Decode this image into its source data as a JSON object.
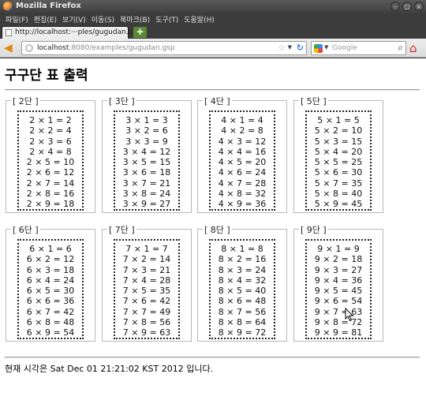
{
  "window": {
    "title": "Mozilla Firefox",
    "buttons": [
      "–",
      "□",
      "×"
    ]
  },
  "menubar": {
    "items": [
      "파일(F)",
      "편집(E)",
      "보기(V)",
      "이동(S)",
      "북마크(B)",
      "도구(T)",
      "도움말(H)"
    ]
  },
  "tab": {
    "label": "http://localhost:···ples/gugudan.gsp",
    "new_tab": "+"
  },
  "navbar": {
    "url_host": "localhost",
    "url_path": ":8080/examples/gugudan.gsp",
    "search_placeholder": "Google"
  },
  "page": {
    "title": "구구단 표 출력",
    "status": "현재 시각은 Sat Dec 01 21:21:02 KST 2012 입니다."
  },
  "tables": [
    {
      "legend": "[ 2단 ]",
      "rows": [
        "2 × 1 = 2",
        "2 × 2 = 4",
        "2 × 3 = 6",
        "2 × 4 = 8",
        "2 × 5 = 10",
        "2 × 6 = 12",
        "2 × 7 = 14",
        "2 × 8 = 16",
        "2 × 9 = 18"
      ]
    },
    {
      "legend": "[ 3단 ]",
      "rows": [
        "3 × 1 = 3",
        "3 × 2 = 6",
        "3 × 3 = 9",
        "3 × 4 = 12",
        "3 × 5 = 15",
        "3 × 6 = 18",
        "3 × 7 = 21",
        "3 × 8 = 24",
        "3 × 9 = 27"
      ]
    },
    {
      "legend": "[ 4단 ]",
      "rows": [
        "4 × 1 = 4",
        "4 × 2 = 8",
        "4 × 3 = 12",
        "4 × 4 = 16",
        "4 × 5 = 20",
        "4 × 6 = 24",
        "4 × 7 = 28",
        "4 × 8 = 32",
        "4 × 9 = 36"
      ]
    },
    {
      "legend": "[ 5단 ]",
      "rows": [
        "5 × 1 = 5",
        "5 × 2 = 10",
        "5 × 3 = 15",
        "5 × 4 = 20",
        "5 × 5 = 25",
        "5 × 6 = 30",
        "5 × 7 = 35",
        "5 × 8 = 40",
        "5 × 9 = 45"
      ]
    },
    {
      "legend": "[ 6단 ]",
      "rows": [
        "6 × 1 = 6",
        "6 × 2 = 12",
        "6 × 3 = 18",
        "6 × 4 = 24",
        "6 × 5 = 30",
        "6 × 6 = 36",
        "6 × 7 = 42",
        "6 × 8 = 48",
        "6 × 9 = 54"
      ]
    },
    {
      "legend": "[ 7단 ]",
      "rows": [
        "7 × 1 = 7",
        "7 × 2 = 14",
        "7 × 3 = 21",
        "7 × 4 = 28",
        "7 × 5 = 35",
        "7 × 6 = 42",
        "7 × 7 = 49",
        "7 × 8 = 56",
        "7 × 9 = 63"
      ]
    },
    {
      "legend": "[ 8단 ]",
      "rows": [
        "8 × 1 = 8",
        "8 × 2 = 16",
        "8 × 3 = 24",
        "8 × 4 = 32",
        "8 × 5 = 40",
        "8 × 6 = 48",
        "8 × 7 = 56",
        "8 × 8 = 64",
        "8 × 9 = 72"
      ]
    },
    {
      "legend": "[ 9단 ]",
      "rows": [
        "9 × 1 = 9",
        "9 × 2 = 18",
        "9 × 3 = 27",
        "9 × 4 = 36",
        "9 × 5 = 45",
        "9 × 6 = 54",
        "9 × 7 = 63",
        "9 × 8 = 72",
        "9 × 9 = 81"
      ]
    }
  ],
  "icons": {
    "back": "back-arrow-icon",
    "home": "home-icon",
    "reload": "reload-icon",
    "search": "magnifier-icon",
    "bookmark": "star-icon"
  }
}
